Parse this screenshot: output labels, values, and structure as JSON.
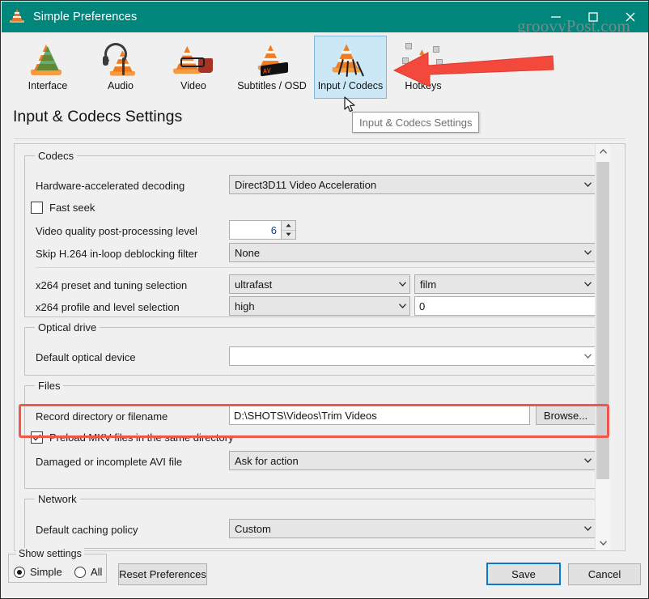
{
  "window": {
    "title": "Simple Preferences",
    "app_icon": "vlc-cone-icon",
    "minimize_label": "Minimize",
    "maximize_label": "Maximize",
    "close_label": "Close"
  },
  "watermark": {
    "text": "groovyPost.com"
  },
  "toolbar": {
    "items": [
      {
        "label": "Interface",
        "icon": "vlc-cone-interface-icon",
        "selected": false
      },
      {
        "label": "Audio",
        "icon": "vlc-cone-headphones-icon",
        "selected": false
      },
      {
        "label": "Video",
        "icon": "vlc-cone-movie-icon",
        "selected": false
      },
      {
        "label": "Subtitles / OSD",
        "icon": "vlc-cone-osd-icon",
        "selected": false
      },
      {
        "label": "Input / Codecs",
        "icon": "vlc-cone-cables-icon",
        "selected": true
      },
      {
        "label": "Hotkeys",
        "icon": "vlc-cone-keys-icon",
        "selected": false
      }
    ]
  },
  "page": {
    "title": "Input & Codecs Settings",
    "tooltip": "Input & Codecs Settings"
  },
  "sections": {
    "codecs": {
      "title": "Codecs",
      "hardware_decoding": {
        "label": "Hardware-accelerated decoding",
        "value": "Direct3D11 Video Acceleration"
      },
      "fast_seek": {
        "label": "Fast seek",
        "checked": false
      },
      "post_processing": {
        "label": "Video quality post-processing level",
        "value": "6"
      },
      "deblocking": {
        "label": "Skip H.264 in-loop deblocking filter",
        "value": "None"
      },
      "x264_preset": {
        "label": "x264 preset and tuning selection",
        "value": "ultrafast",
        "tuning_value": "film"
      },
      "x264_profile": {
        "label": "x264 profile and level selection",
        "value": "high",
        "level_value": "0"
      }
    },
    "optical_drive": {
      "title": "Optical drive",
      "default_device": {
        "label": "Default optical device",
        "value": ""
      }
    },
    "files": {
      "title": "Files",
      "record_directory": {
        "label": "Record directory or filename",
        "value": "D:\\SHOTS\\Videos\\Trim Videos",
        "browse_label": "Browse..."
      },
      "preload_mkv": {
        "label": "Preload MKV files in the same directory",
        "checked": true
      },
      "damaged_avi": {
        "label": "Damaged or incomplete AVI file",
        "value": "Ask for action"
      }
    },
    "network": {
      "title": "Network",
      "caching_policy": {
        "label": "Default caching policy",
        "value": "Custom"
      }
    }
  },
  "footer": {
    "show_settings": {
      "title": "Show settings",
      "simple_label": "Simple",
      "all_label": "All",
      "selected": "Simple"
    },
    "reset_label": "Reset Preferences",
    "save_label": "Save",
    "cancel_label": "Cancel"
  },
  "annotation": {
    "arrow": "red-left-arrow",
    "highlight": "red-highlight-box"
  },
  "colors": {
    "titlebar": "#00867b",
    "selection": "#cce8f6",
    "selection_border": "#7bb8d9",
    "accent_focus": "#0a79d0",
    "annotation_red": "#f0564a",
    "panel": "#f0f0f0"
  }
}
